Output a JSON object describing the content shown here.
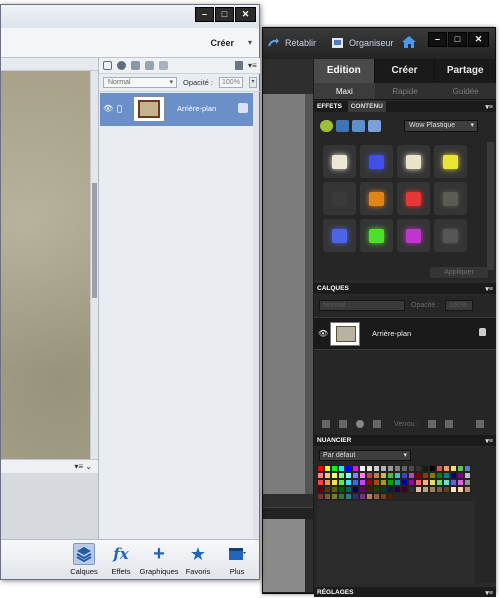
{
  "back_window": {
    "topbar": {
      "undo_label": "Rétablir",
      "organizer_label": "Organiseur"
    },
    "controls": {
      "minimize": "–",
      "maximize": "□",
      "close": "✕"
    },
    "mode_tabs": [
      {
        "label": "Edition",
        "active": true
      },
      {
        "label": "Créer",
        "active": false
      },
      {
        "label": "Partage",
        "active": false
      }
    ],
    "sub_tabs": [
      {
        "label": "Maxi",
        "active": true
      },
      {
        "label": "Rapide",
        "active": false
      },
      {
        "label": "Guidée",
        "active": false
      }
    ],
    "effects": {
      "header": "EFFETS",
      "sub": "CONTENU",
      "dropdown": "Wow Plastique",
      "apply": "Appliquer",
      "swatches": [
        "#ece7d5",
        "#4050e8",
        "#e9e4c8",
        "#e8e635",
        "#3a3a3a",
        "#e38416",
        "#e83535",
        "#5c5c52",
        "#4c64e6",
        "#4de028",
        "#c135cf",
        "#555555"
      ]
    },
    "layers": {
      "header": "CALQUES",
      "mode": "Normal",
      "opacity_label": "Opacité :",
      "opacity": "100%",
      "layer_name": "Arrière-plan",
      "lock_label": "Verrou :"
    },
    "swatches_panel": {
      "header": "NUANCIER",
      "preset": "Par défaut"
    },
    "adjust_header": "RÉGLAGES"
  },
  "front_window": {
    "controls": {
      "minimize": "–",
      "maximize": "□",
      "close": "✕"
    },
    "create_label": "Créer",
    "layers": {
      "mode": "Normal",
      "opacity_label": "Opacité :",
      "opacity": "100%",
      "layer_name": "Arrière-plan"
    },
    "bottom_bar": [
      {
        "label": "Calques",
        "icon": "layers-icon",
        "active": true
      },
      {
        "label": "Effets",
        "icon": "fx-icon",
        "active": false
      },
      {
        "label": "Graphiques",
        "icon": "plus-icon",
        "active": false
      },
      {
        "label": "Favoris",
        "icon": "star-icon",
        "active": false
      },
      {
        "label": "Plus",
        "icon": "panel-icon",
        "active": false
      }
    ]
  }
}
